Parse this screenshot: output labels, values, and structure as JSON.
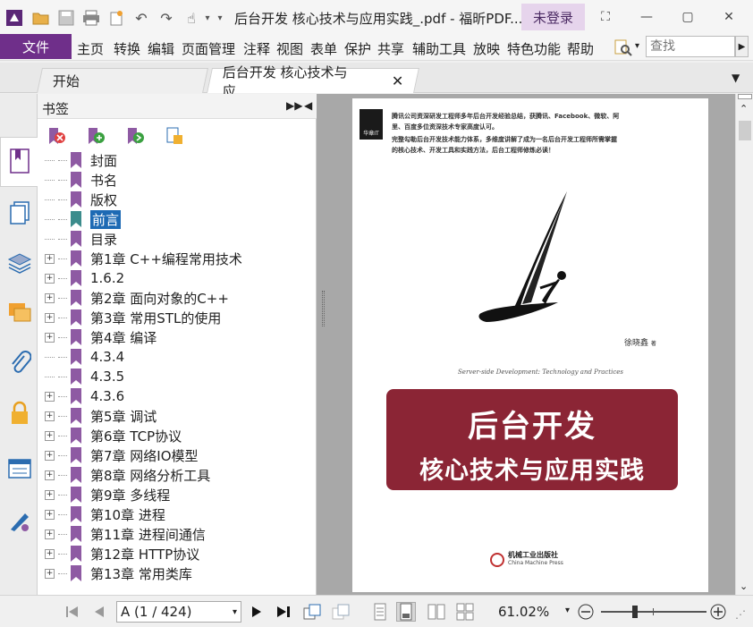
{
  "window": {
    "title": "后台开发 核心技术与应用实践_.pdf - 福昕PDF...",
    "login_label": "未登录"
  },
  "menu": {
    "file": "文件",
    "items": [
      "主页",
      "转换",
      "编辑",
      "页面管理",
      "注释",
      "视图",
      "表单",
      "保护",
      "共享",
      "辅助工具",
      "放映",
      "特色功能",
      "帮助"
    ],
    "search_placeholder": "查找"
  },
  "tabs": [
    {
      "label": "开始"
    },
    {
      "label": "后台开发 核心技术与应...",
      "closable": true
    }
  ],
  "bookmarks": {
    "title": "书签",
    "items": [
      {
        "label": "封面",
        "expandable": false
      },
      {
        "label": "书名",
        "expandable": false
      },
      {
        "label": "版权",
        "expandable": false
      },
      {
        "label": "前言",
        "expandable": false,
        "selected": true
      },
      {
        "label": "目录",
        "expandable": false
      },
      {
        "label": "第1章 C++编程常用技术",
        "expandable": true
      },
      {
        "label": "1.6.2",
        "expandable": true
      },
      {
        "label": "第2章 面向对象的C++",
        "expandable": true
      },
      {
        "label": "第3章 常用STL的使用",
        "expandable": true
      },
      {
        "label": "第4章 编译",
        "expandable": true
      },
      {
        "label": "4.3.4",
        "expandable": false
      },
      {
        "label": "4.3.5",
        "expandable": false
      },
      {
        "label": "4.3.6",
        "expandable": true
      },
      {
        "label": "第5章 调试",
        "expandable": true
      },
      {
        "label": "第6章 TCP协议",
        "expandable": true
      },
      {
        "label": "第7章 网络IO模型",
        "expandable": true
      },
      {
        "label": "第8章 网络分析工具",
        "expandable": true
      },
      {
        "label": "第9章 多线程",
        "expandable": true
      },
      {
        "label": "第10章 进程",
        "expandable": true
      },
      {
        "label": "第11章 进程间通信",
        "expandable": true
      },
      {
        "label": "第12章 HTTP协议",
        "expandable": true
      },
      {
        "label": "第13章 常用类库",
        "expandable": true
      }
    ]
  },
  "cover": {
    "blurb_line1": "腾讯公司资深研发工程师多年后台开发经验总结，获腾讯、Facebook、微软、阿",
    "blurb_line2": "里、百度多位资深技术专家高度认可。",
    "blurb_line3": "完整勾勒后台开发技术能力体系，多维度讲解了成为一名后台开发工程师所需掌握",
    "blurb_line4": "的核心技术、开发工具和实践方法，后台工程师修炼必读！",
    "author": "徐晓鑫",
    "author_suffix": "著",
    "english_title": "Server-side Development: Technology and Practices",
    "title_line1": "后台开发",
    "title_line2": "核心技术与应用实践",
    "publisher_cn": "机械工业出版社",
    "publisher_en": "China Machine Press",
    "series_label": "华章IT"
  },
  "status": {
    "page_indicator": "A (1 / 424)",
    "zoom": "61.02%",
    "zoom_slider_level": 0.3
  },
  "colors": {
    "accent": "#6f2f8a",
    "title_block": "#8b2535",
    "selection": "#1d6ab4",
    "bookmark_flag": "#8e5aa3"
  }
}
